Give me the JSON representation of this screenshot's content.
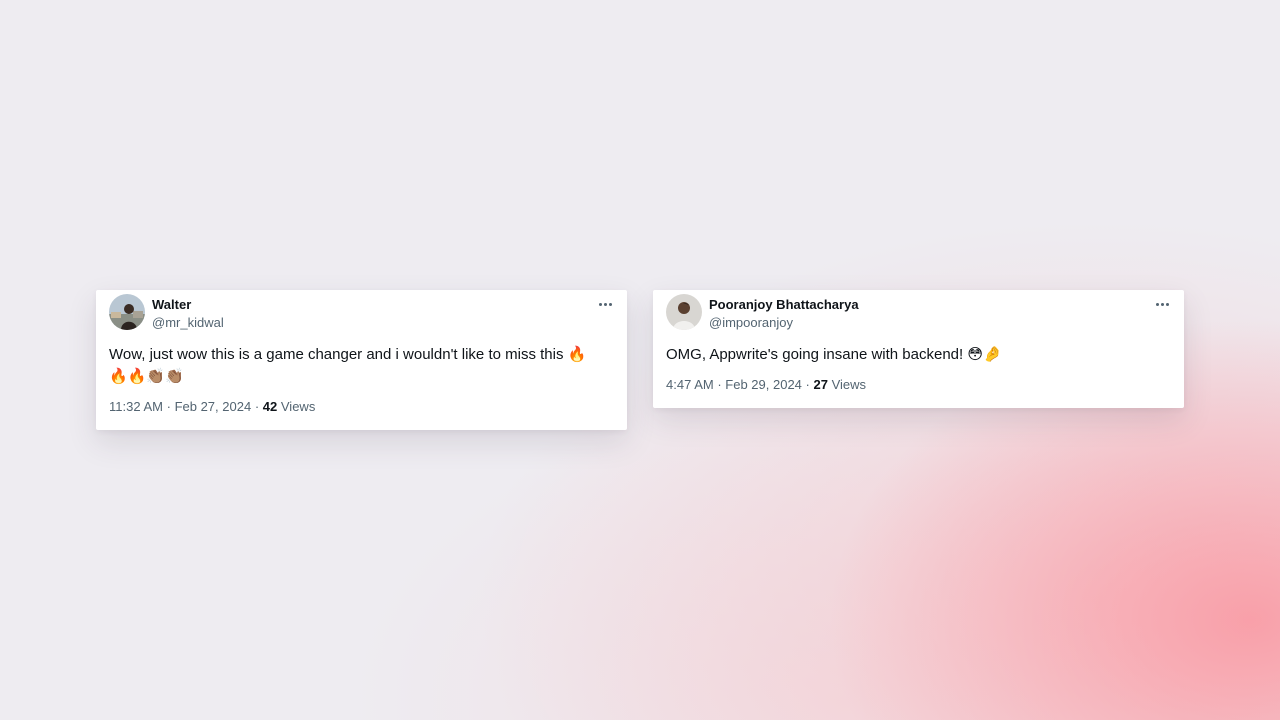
{
  "colors": {
    "background": "#eeecf1",
    "accent_gradient": "#f8a0aa",
    "card_background": "#ffffff",
    "primary_text": "#0f1419",
    "secondary_text": "#536471"
  },
  "tweets": [
    {
      "display_name": "Walter",
      "handle": "@mr_kidwal",
      "text": "Wow, just wow this is a game changer and i wouldn't like to miss this 🔥",
      "emoji_line": "🔥🔥👏🏽👏🏽",
      "time": "11:32 AM",
      "separator1": "·",
      "date": "Feb 27, 2024",
      "separator2": "·",
      "views_count": "42",
      "views_label": "Views",
      "avatar_icon": "user-avatar-photo",
      "more_icon": "more-horizontal-icon"
    },
    {
      "display_name": "Pooranjoy Bhattacharya",
      "handle": "@impooranjoy",
      "text": "OMG, Appwrite's going insane with backend! 😳🤌",
      "time": "4:47 AM",
      "separator1": "·",
      "date": "Feb 29, 2024",
      "separator2": "·",
      "views_count": "27",
      "views_label": "Views",
      "avatar_icon": "user-avatar-photo",
      "more_icon": "more-horizontal-icon"
    }
  ]
}
